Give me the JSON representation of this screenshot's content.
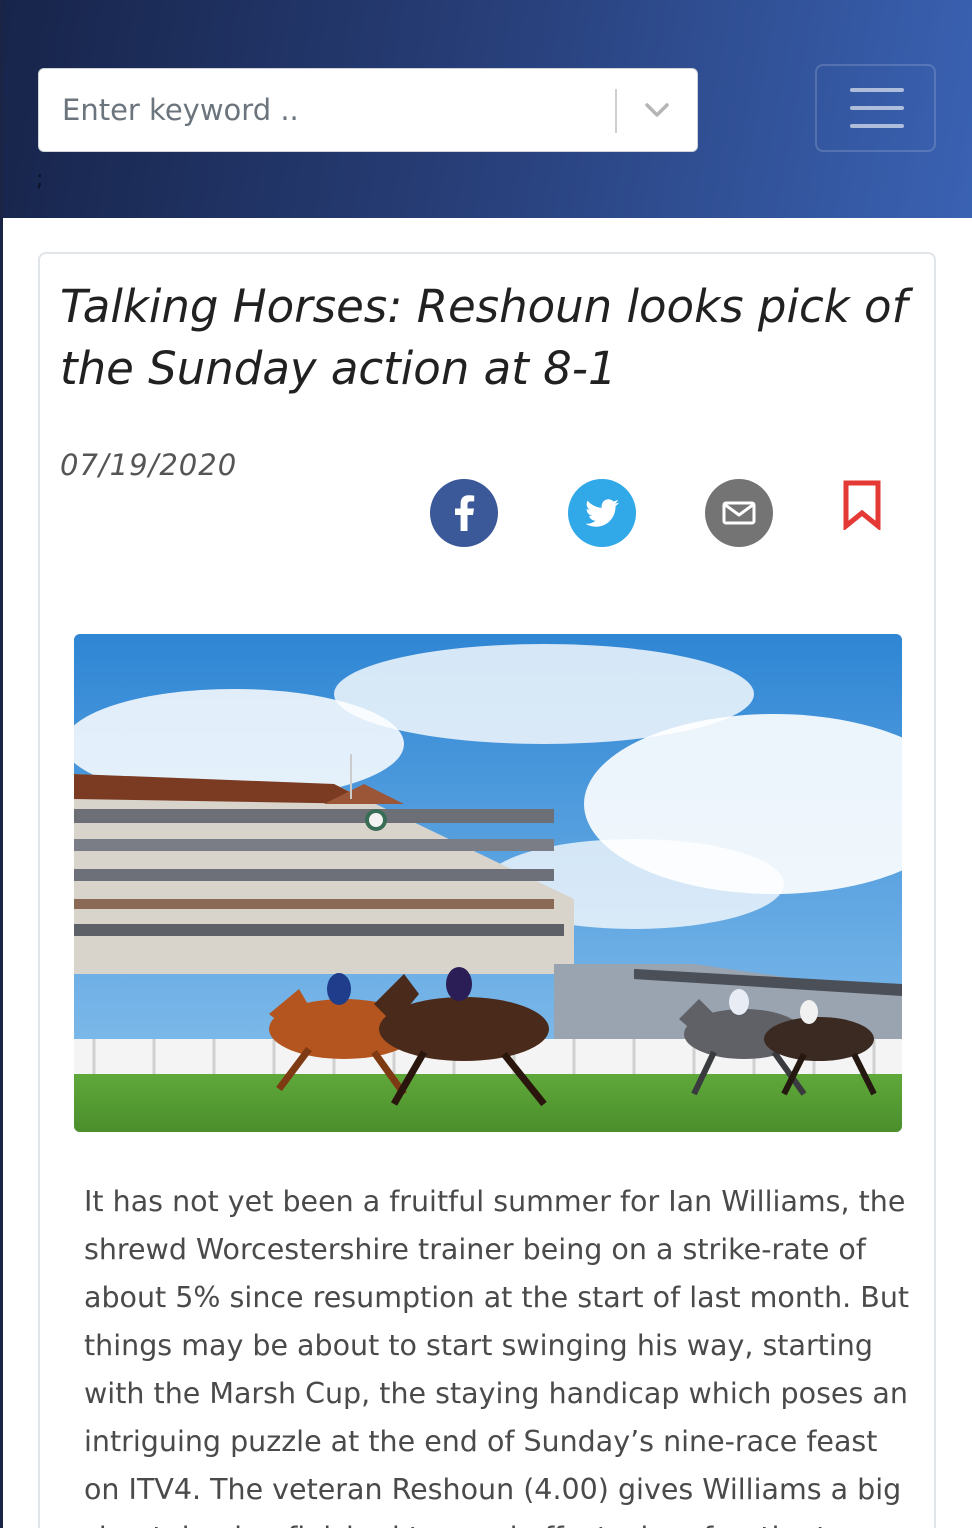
{
  "search": {
    "placeholder": "Enter keyword .."
  },
  "header": {
    "stray_char": ";"
  },
  "menu": {
    "icon": "hamburger-menu-icon"
  },
  "article": {
    "title": "Talking Horses: Reshoun looks pick of the Sunday action at 8-1",
    "date": "07/19/2020",
    "body": "It has not yet been a fruitful summer for Ian Williams, the shrewd Worcestershire trainer being on a strike-rate of about 5% since resumption at the start of last month. But things may be about to start swinging his way, starting with the Marsh Cup, the staying handicap which poses an intriguing puzzle at the end of Sunday’s nine-race feast on ITV4. The veteran Reshoun (4.00) gives Williams a big shout, having finished to good effect when fourth at"
  },
  "share": {
    "buttons": [
      {
        "icon": "facebook-icon",
        "color": "#3b5998"
      },
      {
        "icon": "twitter-icon",
        "color": "#31a8e8"
      },
      {
        "icon": "email-icon",
        "color": "#747474"
      }
    ],
    "bookmark": {
      "icon": "bookmark-icon",
      "color": "#e53935"
    }
  },
  "colors": {
    "header_start": "#17244a",
    "header_end": "#3a62b3",
    "body_text": "#4a4a4a"
  }
}
